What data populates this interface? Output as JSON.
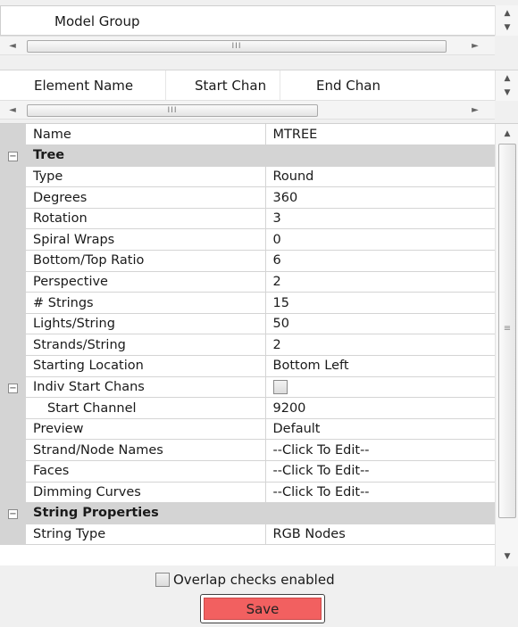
{
  "model_group": {
    "header": "Model Group",
    "scroll_grip": "III"
  },
  "element_list": {
    "columns": [
      "Element Name",
      "Start Chan",
      "End Chan"
    ],
    "scroll_grip": "III"
  },
  "properties": {
    "top_row": {
      "name": "Name",
      "value": "MTREE"
    },
    "tree_category": "Tree",
    "tree_rows": [
      {
        "name": "Type",
        "value": "Round"
      },
      {
        "name": "Degrees",
        "value": "360"
      },
      {
        "name": "Rotation",
        "value": "3"
      },
      {
        "name": "Spiral Wraps",
        "value": "0"
      },
      {
        "name": "Bottom/Top Ratio",
        "value": "6"
      },
      {
        "name": "Perspective",
        "value": "2"
      },
      {
        "name": "# Strings",
        "value": "15"
      },
      {
        "name": "Lights/String",
        "value": "50"
      },
      {
        "name": "Strands/String",
        "value": "2"
      },
      {
        "name": "Starting Location",
        "value": "Bottom Left"
      }
    ],
    "indiv_start_chans": {
      "name": "Indiv Start Chans",
      "checked": false
    },
    "start_channel": {
      "name": "Start Channel",
      "value": "9200"
    },
    "more_rows": [
      {
        "name": "Preview",
        "value": "Default"
      },
      {
        "name": "Strand/Node Names",
        "value": "--Click To Edit--"
      },
      {
        "name": "Faces",
        "value": "--Click To Edit--"
      },
      {
        "name": "Dimming Curves",
        "value": "--Click To Edit--"
      }
    ],
    "string_category": "String Properties",
    "string_rows": [
      {
        "name": "String Type",
        "value": "RGB Nodes"
      }
    ]
  },
  "overlap": {
    "label": "Overlap checks enabled",
    "checked": false
  },
  "save_button": {
    "label": "Save",
    "color": "#f26060"
  }
}
